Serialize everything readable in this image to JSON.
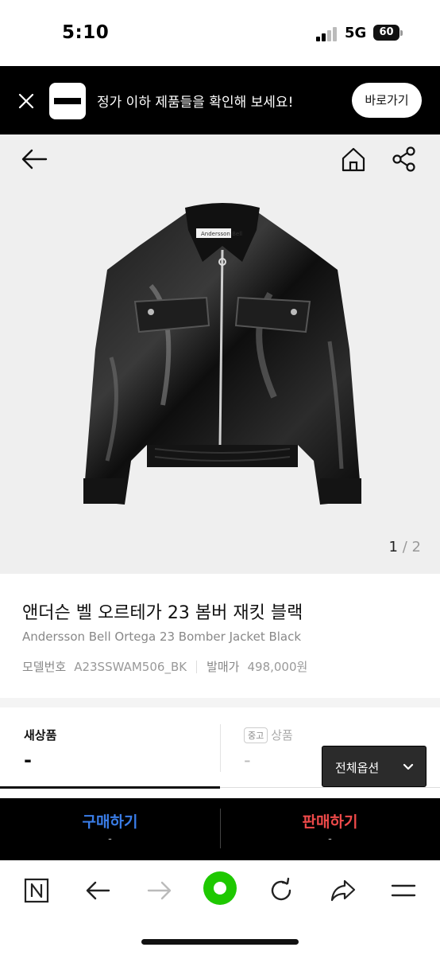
{
  "status_bar": {
    "time": "5:10",
    "network": "5G",
    "battery": "60",
    "icons": [
      "signal-icon",
      "battery-icon"
    ]
  },
  "banner": {
    "message": "정가 이하 제품들을 확인해 보세요!",
    "button_label": "바로가기",
    "icons": [
      "close-icon",
      "brand-logo"
    ]
  },
  "hero": {
    "image_page_current": "1",
    "image_page_separator": "/",
    "image_page_total": "2",
    "icons": [
      "back-arrow-icon",
      "home-icon",
      "share-icon"
    ],
    "brand_tag": "Andersson Bell",
    "background_color": "#efefef"
  },
  "product": {
    "title_ko": "앤더슨 벨 오르테가 23 봄버 재킷 블랙",
    "title_en": "Andersson Bell Ortega 23 Bomber Jacket Black",
    "model_label": "모델번호",
    "model_value": "A23SSWAM506_BK",
    "release_price_label": "발매가",
    "release_price_value": "498,000원"
  },
  "price_tabs": {
    "new_label": "새상품",
    "new_price": "-",
    "used_badge": "중고",
    "used_label": "상품",
    "used_price": "-",
    "options_label": "전체옵션"
  },
  "trade_bar": {
    "buy_label": "구매하기",
    "buy_sub": "-",
    "sell_label": "판매하기",
    "sell_sub": "-",
    "buy_color": "#3a7de8",
    "sell_color": "#ef4a4a"
  },
  "browser_toolbar": {
    "icons": [
      "naver-n-icon",
      "back-icon",
      "forward-icon",
      "green-home-icon",
      "refresh-icon",
      "share-icon",
      "menu-icon"
    ],
    "accent": "#1ec800"
  }
}
